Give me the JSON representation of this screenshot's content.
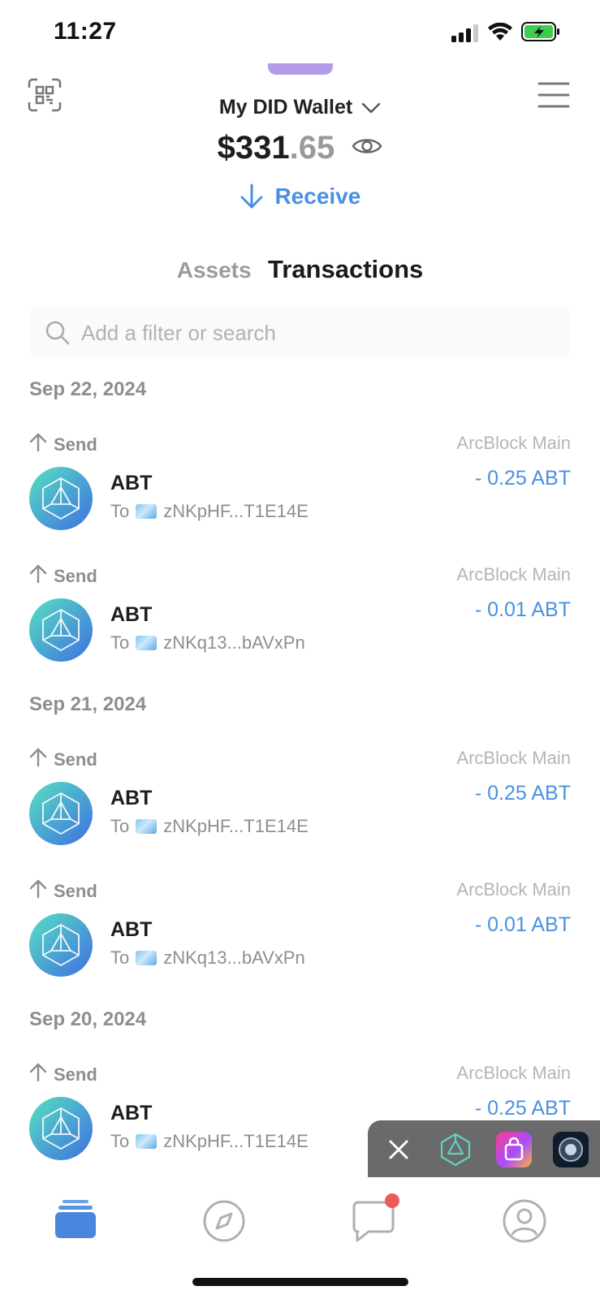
{
  "status_bar": {
    "time": "11:27"
  },
  "header": {
    "wallet_name": "My DID Wallet",
    "balance_integer": "$331",
    "balance_decimal": ".65",
    "receive_label": "Receive"
  },
  "tabs": {
    "assets": "Assets",
    "transactions": "Transactions",
    "active": "Transactions"
  },
  "search": {
    "placeholder": "Add a filter or search"
  },
  "groups": [
    {
      "date": "Sep 22, 2024",
      "transactions": [
        {
          "type": "Send",
          "chain": "ArcBlock Main",
          "token": "ABT",
          "to_prefix": "To",
          "address": "zNKpHF...T1E14E",
          "amount": "- 0.25 ABT"
        },
        {
          "type": "Send",
          "chain": "ArcBlock Main",
          "token": "ABT",
          "to_prefix": "To",
          "address": "zNKq13...bAVxPn",
          "amount": "- 0.01 ABT"
        }
      ]
    },
    {
      "date": "Sep 21, 2024",
      "transactions": [
        {
          "type": "Send",
          "chain": "ArcBlock Main",
          "token": "ABT",
          "to_prefix": "To",
          "address": "zNKpHF...T1E14E",
          "amount": "- 0.25 ABT"
        },
        {
          "type": "Send",
          "chain": "ArcBlock Main",
          "token": "ABT",
          "to_prefix": "To",
          "address": "zNKq13...bAVxPn",
          "amount": "- 0.01 ABT"
        }
      ]
    },
    {
      "date": "Sep 20, 2024",
      "transactions": [
        {
          "type": "Send",
          "chain": "ArcBlock Main",
          "token": "ABT",
          "to_prefix": "To",
          "address": "zNKpHF...T1E14E",
          "amount": "- 0.25 ABT"
        }
      ]
    }
  ],
  "colors": {
    "accent": "#4a90e2",
    "muted": "#8e8e8e",
    "badge": "#ea5b5b"
  },
  "icons": {
    "header": [
      "scan-icon",
      "menu-icon",
      "chevron-down-icon",
      "eye-icon",
      "arrow-down-icon"
    ],
    "nav": [
      "wallet-icon",
      "compass-icon",
      "chat-icon",
      "profile-icon"
    ],
    "floating": [
      "close-icon",
      "abt-app-icon",
      "store-app-icon",
      "dark-app-icon"
    ]
  }
}
